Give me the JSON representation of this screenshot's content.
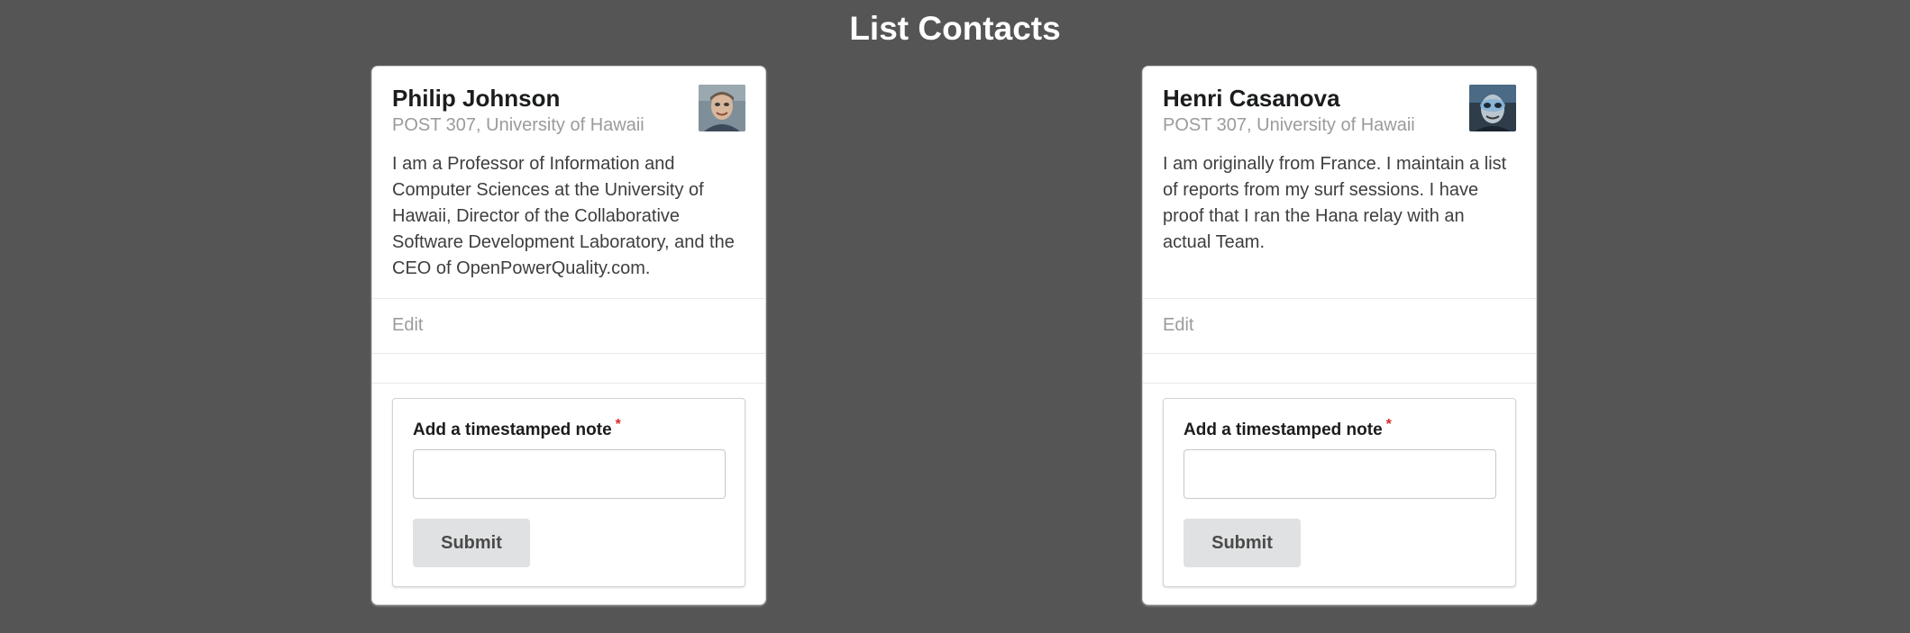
{
  "page": {
    "title": "List Contacts"
  },
  "contacts": [
    {
      "name": "Philip Johnson",
      "address": "POST 307, University of Hawaii",
      "description": "I am a Professor of Information and Computer Sciences at the University of Hawaii, Director of the Collaborative Software Development Laboratory, and the CEO of OpenPowerQuality.com.",
      "edit_label": "Edit",
      "note_form": {
        "label": "Add a timestamped note",
        "required_marker": "*",
        "input_value": "",
        "submit_label": "Submit"
      }
    },
    {
      "name": "Henri Casanova",
      "address": "POST 307, University of Hawaii",
      "description": "I am originally from France. I maintain a list of reports from my surf sessions. I have proof that I ran the Hana relay with an actual Team.",
      "edit_label": "Edit",
      "note_form": {
        "label": "Add a timestamped note",
        "required_marker": "*",
        "input_value": "",
        "submit_label": "Submit"
      }
    }
  ],
  "colors": {
    "background": "#555555",
    "card": "#ffffff",
    "meta_text": "#9b9b9b",
    "required": "#db2828",
    "button": "#e0e1e2"
  }
}
